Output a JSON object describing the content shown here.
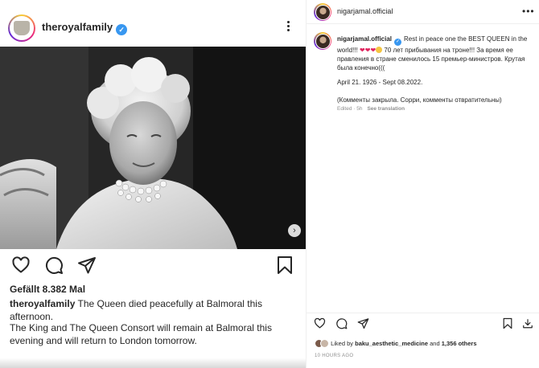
{
  "left_post": {
    "username": "theroyalfamily",
    "likes_text": "Gefällt 8.382 Mal",
    "caption_username": "theroyalfamily",
    "caption_text": "The Queen died peacefully at Balmoral this afternoon.",
    "caption_text_2": "The King and The Queen Consort will remain at Balmoral this evening and will return to London tomorrow.",
    "icons": [
      "heart-icon",
      "comment-icon",
      "share-icon",
      "bookmark-icon",
      "more-icon",
      "next-arrow-icon",
      "verified-badge-icon"
    ]
  },
  "right_pane": {
    "header_username": "nigarjamal.official",
    "comment": {
      "username": "nigarjamal.official",
      "text_1": "Rest in peace one the BEST QUEEN in the world!!!",
      "hearts": "❤❤❤",
      "text_2": "70 лет прибывания на троне!!! За время ее правления в стране сменилось 15 премьер-министров. Крутая была конечно(((",
      "dates": "April 21. 1926 - Sept 08.2022.",
      "note": "(Комменты закрыла. Сорри, комменты отвратительны)",
      "edited": "Edited · 5h",
      "see_translation": "See translation"
    },
    "liked_by_prefix": "Liked by",
    "liked_by_user": "baku_aesthetic_medicine",
    "liked_by_and": "and",
    "liked_by_others": "1,356 others",
    "time_ago": "10 HOURS AGO"
  },
  "colors": {
    "verified": "#3897f0",
    "text": "#262626",
    "muted": "#8e8e8e"
  }
}
